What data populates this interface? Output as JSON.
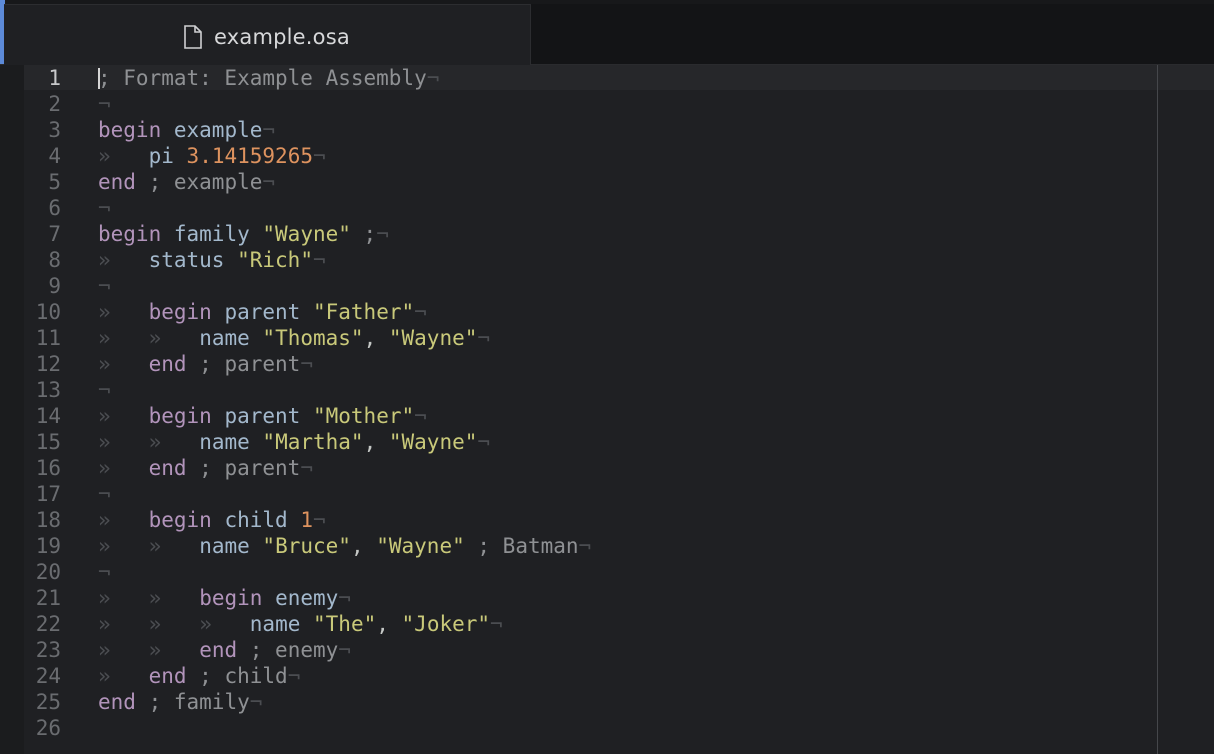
{
  "tab": {
    "title": "example.osa",
    "icon": "file-icon"
  },
  "colors": {
    "accent": "#5c8ad8",
    "keyword": "#b294bb",
    "string": "#c9c97a",
    "number": "#de935f",
    "comment": "#8f9194",
    "invisible": "#4b4d51"
  },
  "invisibles": {
    "eol": "¬",
    "tab": "»"
  },
  "editor": {
    "current_line": 1,
    "lines": [
      {
        "num": "1",
        "indent": 0,
        "tokens": [
          {
            "t": "; Format: Example Assembly",
            "c": "comment"
          }
        ]
      },
      {
        "num": "2",
        "indent": 0,
        "tokens": []
      },
      {
        "num": "3",
        "indent": 0,
        "tokens": [
          {
            "t": "begin",
            "c": "keyword"
          },
          {
            "t": " ",
            "c": "punct"
          },
          {
            "t": "example",
            "c": "ident"
          }
        ]
      },
      {
        "num": "4",
        "indent": 1,
        "tokens": [
          {
            "t": "pi",
            "c": "ident"
          },
          {
            "t": " ",
            "c": "punct"
          },
          {
            "t": "3.14159265",
            "c": "number"
          }
        ]
      },
      {
        "num": "5",
        "indent": 0,
        "tokens": [
          {
            "t": "end",
            "c": "keyword"
          },
          {
            "t": " ; example",
            "c": "comment"
          }
        ]
      },
      {
        "num": "6",
        "indent": 0,
        "tokens": []
      },
      {
        "num": "7",
        "indent": 0,
        "tokens": [
          {
            "t": "begin",
            "c": "keyword"
          },
          {
            "t": " ",
            "c": "punct"
          },
          {
            "t": "family",
            "c": "ident"
          },
          {
            "t": " ",
            "c": "punct"
          },
          {
            "t": "\"Wayne\"",
            "c": "string"
          },
          {
            "t": " ;",
            "c": "comment"
          }
        ]
      },
      {
        "num": "8",
        "indent": 1,
        "tokens": [
          {
            "t": "status",
            "c": "ident"
          },
          {
            "t": " ",
            "c": "punct"
          },
          {
            "t": "\"Rich\"",
            "c": "string"
          }
        ]
      },
      {
        "num": "9",
        "indent": 0,
        "tokens": []
      },
      {
        "num": "10",
        "indent": 1,
        "tokens": [
          {
            "t": "begin",
            "c": "keyword"
          },
          {
            "t": " ",
            "c": "punct"
          },
          {
            "t": "parent",
            "c": "ident"
          },
          {
            "t": " ",
            "c": "punct"
          },
          {
            "t": "\"Father\"",
            "c": "string"
          }
        ]
      },
      {
        "num": "11",
        "indent": 2,
        "tokens": [
          {
            "t": "name",
            "c": "ident"
          },
          {
            "t": " ",
            "c": "punct"
          },
          {
            "t": "\"Thomas\"",
            "c": "string"
          },
          {
            "t": ", ",
            "c": "punct"
          },
          {
            "t": "\"Wayne\"",
            "c": "string"
          }
        ]
      },
      {
        "num": "12",
        "indent": 1,
        "tokens": [
          {
            "t": "end",
            "c": "keyword"
          },
          {
            "t": " ; parent",
            "c": "comment"
          }
        ]
      },
      {
        "num": "13",
        "indent": 0,
        "tokens": []
      },
      {
        "num": "14",
        "indent": 1,
        "tokens": [
          {
            "t": "begin",
            "c": "keyword"
          },
          {
            "t": " ",
            "c": "punct"
          },
          {
            "t": "parent",
            "c": "ident"
          },
          {
            "t": " ",
            "c": "punct"
          },
          {
            "t": "\"Mother\"",
            "c": "string"
          }
        ]
      },
      {
        "num": "15",
        "indent": 2,
        "tokens": [
          {
            "t": "name",
            "c": "ident"
          },
          {
            "t": " ",
            "c": "punct"
          },
          {
            "t": "\"Martha\"",
            "c": "string"
          },
          {
            "t": ", ",
            "c": "punct"
          },
          {
            "t": "\"Wayne\"",
            "c": "string"
          }
        ]
      },
      {
        "num": "16",
        "indent": 1,
        "tokens": [
          {
            "t": "end",
            "c": "keyword"
          },
          {
            "t": " ; parent",
            "c": "comment"
          }
        ]
      },
      {
        "num": "17",
        "indent": 0,
        "tokens": []
      },
      {
        "num": "18",
        "indent": 1,
        "tokens": [
          {
            "t": "begin",
            "c": "keyword"
          },
          {
            "t": " ",
            "c": "punct"
          },
          {
            "t": "child",
            "c": "ident"
          },
          {
            "t": " ",
            "c": "punct"
          },
          {
            "t": "1",
            "c": "number"
          }
        ]
      },
      {
        "num": "19",
        "indent": 2,
        "tokens": [
          {
            "t": "name",
            "c": "ident"
          },
          {
            "t": " ",
            "c": "punct"
          },
          {
            "t": "\"Bruce\"",
            "c": "string"
          },
          {
            "t": ", ",
            "c": "punct"
          },
          {
            "t": "\"Wayne\"",
            "c": "string"
          },
          {
            "t": " ; Batman",
            "c": "comment"
          }
        ]
      },
      {
        "num": "20",
        "indent": 0,
        "tokens": []
      },
      {
        "num": "21",
        "indent": 2,
        "tokens": [
          {
            "t": "begin",
            "c": "keyword"
          },
          {
            "t": " ",
            "c": "punct"
          },
          {
            "t": "enemy",
            "c": "ident"
          }
        ]
      },
      {
        "num": "22",
        "indent": 3,
        "tokens": [
          {
            "t": "name",
            "c": "ident"
          },
          {
            "t": " ",
            "c": "punct"
          },
          {
            "t": "\"The\"",
            "c": "string"
          },
          {
            "t": ", ",
            "c": "punct"
          },
          {
            "t": "\"Joker\"",
            "c": "string"
          }
        ]
      },
      {
        "num": "23",
        "indent": 2,
        "tokens": [
          {
            "t": "end",
            "c": "keyword"
          },
          {
            "t": " ; enemy",
            "c": "comment"
          }
        ]
      },
      {
        "num": "24",
        "indent": 1,
        "tokens": [
          {
            "t": "end",
            "c": "keyword"
          },
          {
            "t": " ; child",
            "c": "comment"
          }
        ]
      },
      {
        "num": "25",
        "indent": 0,
        "tokens": [
          {
            "t": "end",
            "c": "keyword"
          },
          {
            "t": " ; family",
            "c": "comment"
          }
        ]
      },
      {
        "num": "26",
        "indent": 0,
        "tokens": [],
        "no_eol": true
      }
    ]
  }
}
